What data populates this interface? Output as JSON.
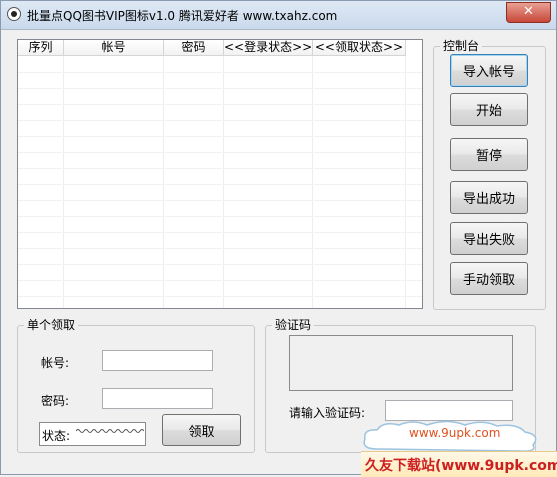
{
  "window": {
    "title": "批量点QQ图书VIP图标v1.0 腾讯爱好者 www.txahz.com",
    "close_label": "✕"
  },
  "list": {
    "columns": [
      "序列",
      "帐号",
      "密码",
      "<<登录状态>>",
      "<<领取状态>>"
    ],
    "rows": []
  },
  "control_panel": {
    "title": "控制台",
    "buttons": {
      "import": "导入帐号",
      "start": "开始",
      "pause": "暂停",
      "export_success": "导出成功",
      "export_fail": "导出失败",
      "manual": "手动领取"
    }
  },
  "single": {
    "title": "单个领取",
    "account_label": "帐号:",
    "password_label": "密码:",
    "account_value": "",
    "password_value": "",
    "status_label": "状态:",
    "claim_button": "领取"
  },
  "captcha": {
    "title": "验证码",
    "input_label": "请输入验证码:",
    "input_value": ""
  },
  "watermark": {
    "url": "www.9upk.com",
    "site": "久友下载站(www.9upk.com)"
  }
}
